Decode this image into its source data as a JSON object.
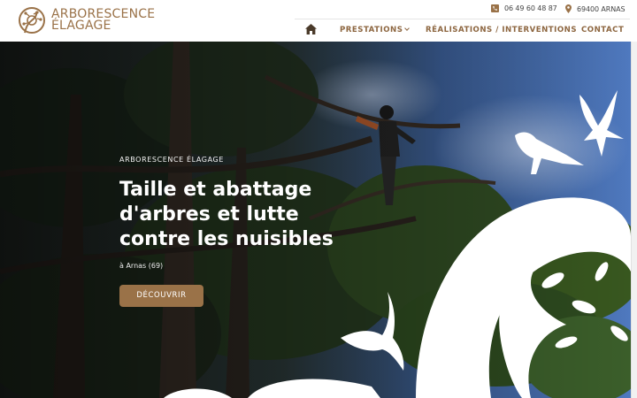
{
  "brand": {
    "name_line1": "ARBORESCENCE",
    "name_line2": "ÉLAGAGE",
    "logo_icon": "tree-circle-logo-icon",
    "color": "#9a7248"
  },
  "topbar": {
    "phone": "06 49 60 48 87",
    "phone_icon": "phone-icon",
    "location": "69400 ARNAS",
    "location_icon": "map-pin-icon"
  },
  "nav": {
    "home_icon": "home-icon",
    "items": [
      {
        "label": "PRESTATIONS",
        "has_dropdown": true
      },
      {
        "label": "RÉALISATIONS / INTERVENTIONS"
      },
      {
        "label": "CONTACT"
      }
    ]
  },
  "hero": {
    "eyebrow": "ARBORESCENCE ÉLAGAGE",
    "title": "Taille et abattage d'arbres et lutte contre les nuisibles",
    "location": "à Arnas (69)",
    "cta_label": "DÉCOUVRIR",
    "cta_color": "#9a7248"
  }
}
